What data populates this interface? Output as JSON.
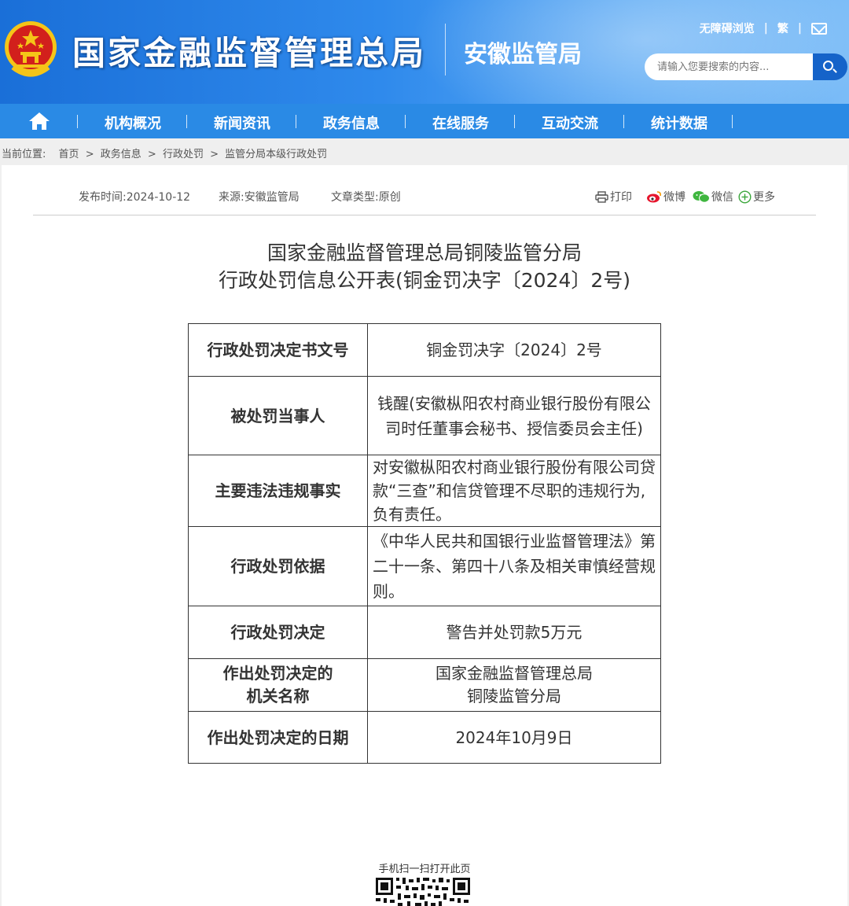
{
  "header": {
    "site_title": "国家金融监督管理总局",
    "branch_title": "安徽监管局",
    "util_links": {
      "accessible": "无障碍浏览",
      "traditional": "繁"
    },
    "search_placeholder": "请输入您要搜索的内容..."
  },
  "nav": {
    "items": [
      "机构概况",
      "新闻资讯",
      "政务信息",
      "在线服务",
      "互动交流",
      "统计数据"
    ]
  },
  "breadcrumb": {
    "label": "当前位置:",
    "items": [
      "首页",
      "政务信息",
      "行政处罚",
      "监管分局本级行政处罚"
    ],
    "separator": ">"
  },
  "meta": {
    "publish_time": "发布时间:2024-10-12",
    "source": "来源:安徽监管局",
    "doc_type": "文章类型:原创"
  },
  "share": {
    "print": "打印",
    "weibo": "微博",
    "wechat": "微信",
    "more": "更多"
  },
  "document": {
    "title_line1": "国家金融监督管理总局铜陵监管分局",
    "title_line2": "行政处罚信息公开表(铜金罚决字〔2024〕2号)",
    "rows": [
      {
        "key": "行政处罚决定书文号",
        "value": "铜金罚决字〔2024〕2号"
      },
      {
        "key": "被处罚当事人",
        "value": "钱醒(安徽枞阳农村商业银行股份有限公司时任董事会秘书、授信委员会主任)"
      },
      {
        "key": "主要违法违规事实",
        "value": "对安徽枞阳农村商业银行股份有限公司贷款“三查”和信贷管理不尽职的违规行为,负有责任。"
      },
      {
        "key": "行政处罚依据",
        "value": "《中华人民共和国银行业监督管理法》第二十一条、第四十八条及相关审慎经营规则。"
      },
      {
        "key": "行政处罚决定",
        "value": "警告并处罚款5万元"
      },
      {
        "key_line1": "作出处罚决定的",
        "key_line2": "机关名称",
        "value_line1": "国家金融监督管理总局",
        "value_line2": "铜陵监管分局"
      },
      {
        "key": "作出处罚决定的日期",
        "value": "2024年10月9日"
      }
    ]
  },
  "footer": {
    "qr_label": "手机扫一扫打开此页"
  },
  "icons": {
    "emblem": "national-emblem-icon",
    "home": "home-icon",
    "search": "search-icon",
    "mail": "mail-icon",
    "print": "printer-icon",
    "weibo": "weibo-icon",
    "wechat": "wechat-icon",
    "more": "plus-circle-icon"
  },
  "colors": {
    "header_blue": "#2f8aec",
    "nav_blue": "#2a8ae5",
    "search_button": "#1563c9",
    "emblem_red": "#d2201c",
    "emblem_gold": "#f5c518",
    "wechat_green": "#3fb63f",
    "more_green": "#3aa63a",
    "weibo_red": "#e6162d"
  }
}
